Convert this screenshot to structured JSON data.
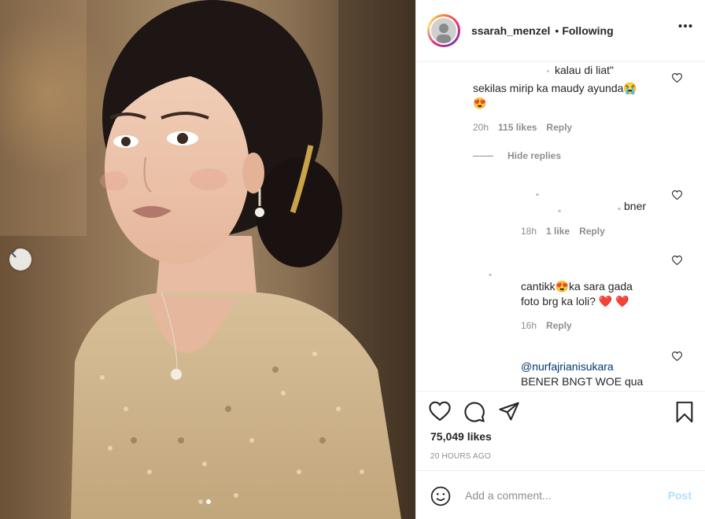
{
  "post": {
    "username": "ssarah_menzel",
    "bullet": "•",
    "follow_state": "Following",
    "likes": "75,049 likes",
    "time_ago": "20 HOURS AGO",
    "carousel": {
      "total": 2,
      "active_index": 1
    }
  },
  "comments": [
    {
      "text_line1": "kalau di liat\"",
      "text_line2": "sekilas mirip ka maudy ayunda😭",
      "text_line3": "😍",
      "time": "20h",
      "likes": "115 likes",
      "reply": "Reply"
    },
    {
      "hide_replies": "Hide replies"
    },
    {
      "text": "bner",
      "time": "18h",
      "likes": "1 like",
      "reply": "Reply"
    },
    {
      "text_line1": "cantikk😍ka sara gada",
      "text_line2": "foto brg ka loli? ❤️ ❤️",
      "time": "16h",
      "reply": "Reply"
    },
    {
      "mention": "@nurfajrianisukara",
      "text_line2": "BENER BNGT WOE qua"
    }
  ],
  "add_comment": {
    "placeholder": "Add a comment...",
    "post_label": "Post"
  },
  "icons": {
    "more": "more-options-icon",
    "like": "heart-icon",
    "comment": "comment-icon",
    "share": "share-icon",
    "save": "bookmark-icon",
    "emoji": "emoji-icon",
    "prev": "chevron-left-icon"
  },
  "colors": {
    "text": "#262626",
    "muted": "#8e8e8e",
    "mention": "#00376b",
    "post_disabled": "#b2dffc",
    "heart_emoji": "#ed4956"
  }
}
